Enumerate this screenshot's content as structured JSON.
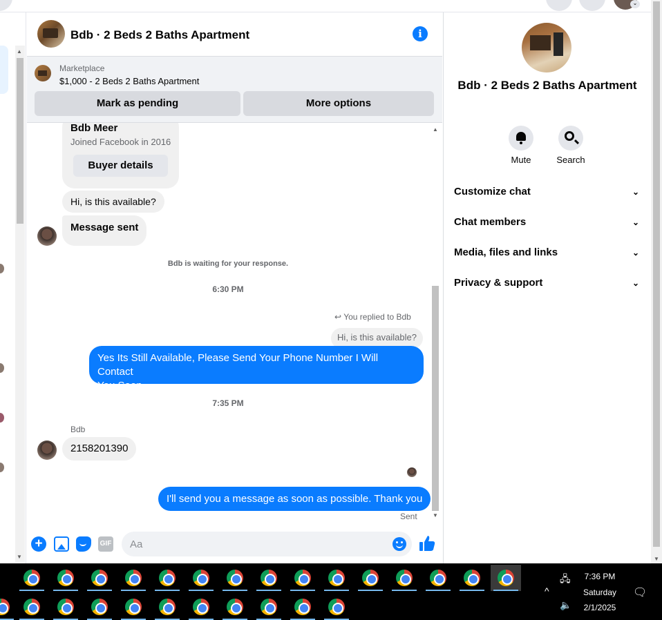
{
  "chat": {
    "title": "Bdb · 2 Beds 2 Baths Apartment"
  },
  "marketplace": {
    "label": "Marketplace",
    "item": "$1,000 - 2 Beds 2 Baths Apartment",
    "mark_pending": "Mark as pending",
    "more_options": "More options"
  },
  "buyer_card": {
    "name": "Bdb Meer",
    "joined": "Joined Facebook in 2016",
    "details_button": "Buyer details"
  },
  "messages": {
    "m1": "Hi, is this available?",
    "m2": "Message sent",
    "waiting": "Bdb is waiting for your response.",
    "time1": "6:30 PM",
    "reply_note": "You replied to Bdb",
    "quoted": "Hi, is this available?",
    "out1_line1": "Yes Its Still Available, Please Send Your Phone Number I Will Contact",
    "out1_line2": "You Soon.",
    "time2": "7:35 PM",
    "sender": "Bdb",
    "in2": "2158201390",
    "out2": "I'll send you a message as soon as possible. Thank you",
    "status": "Sent"
  },
  "composer": {
    "placeholder": "Aa",
    "gif_label": "GIF"
  },
  "panel": {
    "title": "Bdb · 2 Beds 2 Baths Apartment",
    "mute": "Mute",
    "search": "Search",
    "rows": [
      "Customize chat",
      "Chat members",
      "Media, files and links",
      "Privacy & support"
    ]
  },
  "taskbar": {
    "time": "7:36 PM",
    "day": "Saturday",
    "date": "2/1/2025"
  },
  "colors": {
    "accent": "#0a7cff",
    "bubble_in": "#f0f0f0",
    "panel_bg": "#f0f2f5"
  },
  "icons": [
    "info-icon",
    "bell-icon",
    "search-icon",
    "chevron-down-icon",
    "plus-icon",
    "photo-icon",
    "sticker-icon",
    "gif-icon",
    "emoji-icon",
    "like-icon",
    "reply-icon",
    "chrome-icon",
    "network-icon",
    "volume-icon",
    "notification-icon"
  ]
}
